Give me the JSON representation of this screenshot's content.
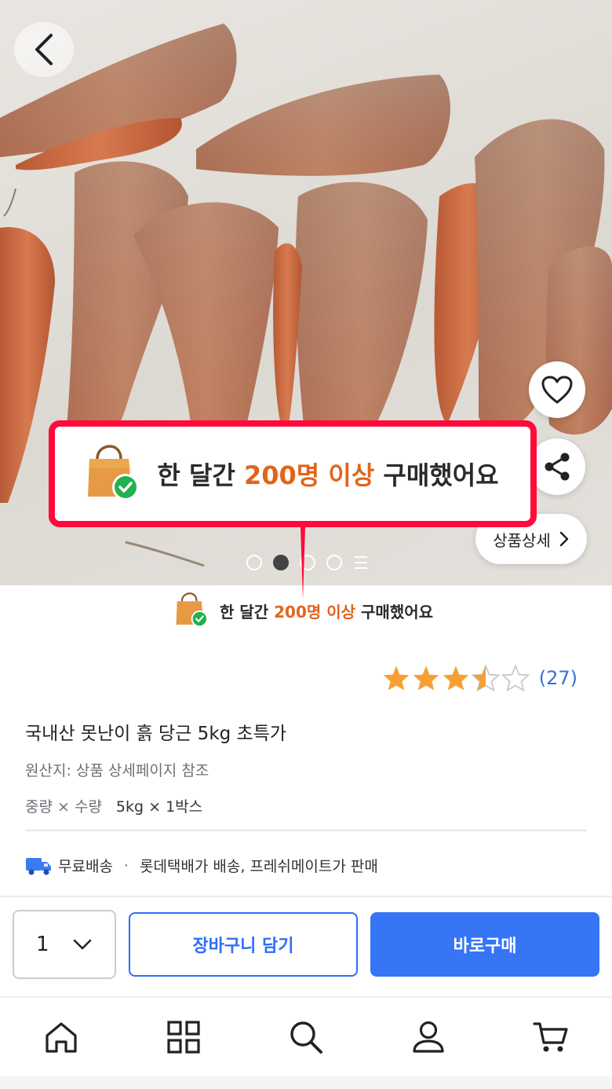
{
  "badge": {
    "prefix": "한 달간 ",
    "highlight": "200명 이상",
    "suffix": " 구매했어요",
    "highlight_color": "#e0651c",
    "callout_border_color": "#ff0a3a"
  },
  "gallery": {
    "detail_button": "상품상세",
    "total_pages": 4,
    "active_page": 2
  },
  "rating": {
    "stars": 3.5,
    "max": 5,
    "count_text": "(27)",
    "star_color": "#f5a035"
  },
  "product": {
    "title": "국내산 못난이 흙 당근 5kg 초특가",
    "origin": "원산지: 상품 상세페이지 참조",
    "spec_label": "중량 × 수량",
    "spec_value": "5kg × 1박스"
  },
  "shipping": {
    "free": "무료배송",
    "separator": "·",
    "info": "롯데택배가 배송, 프레쉬메이트가 판매"
  },
  "actions": {
    "quantity": "1",
    "add_to_cart": "장바구니 담기",
    "buy_now": "바로구매",
    "primary_color": "#3575f6"
  },
  "bottom_nav": {
    "items": [
      "home-icon",
      "category-icon",
      "search-icon",
      "user-icon",
      "cart-icon"
    ]
  }
}
